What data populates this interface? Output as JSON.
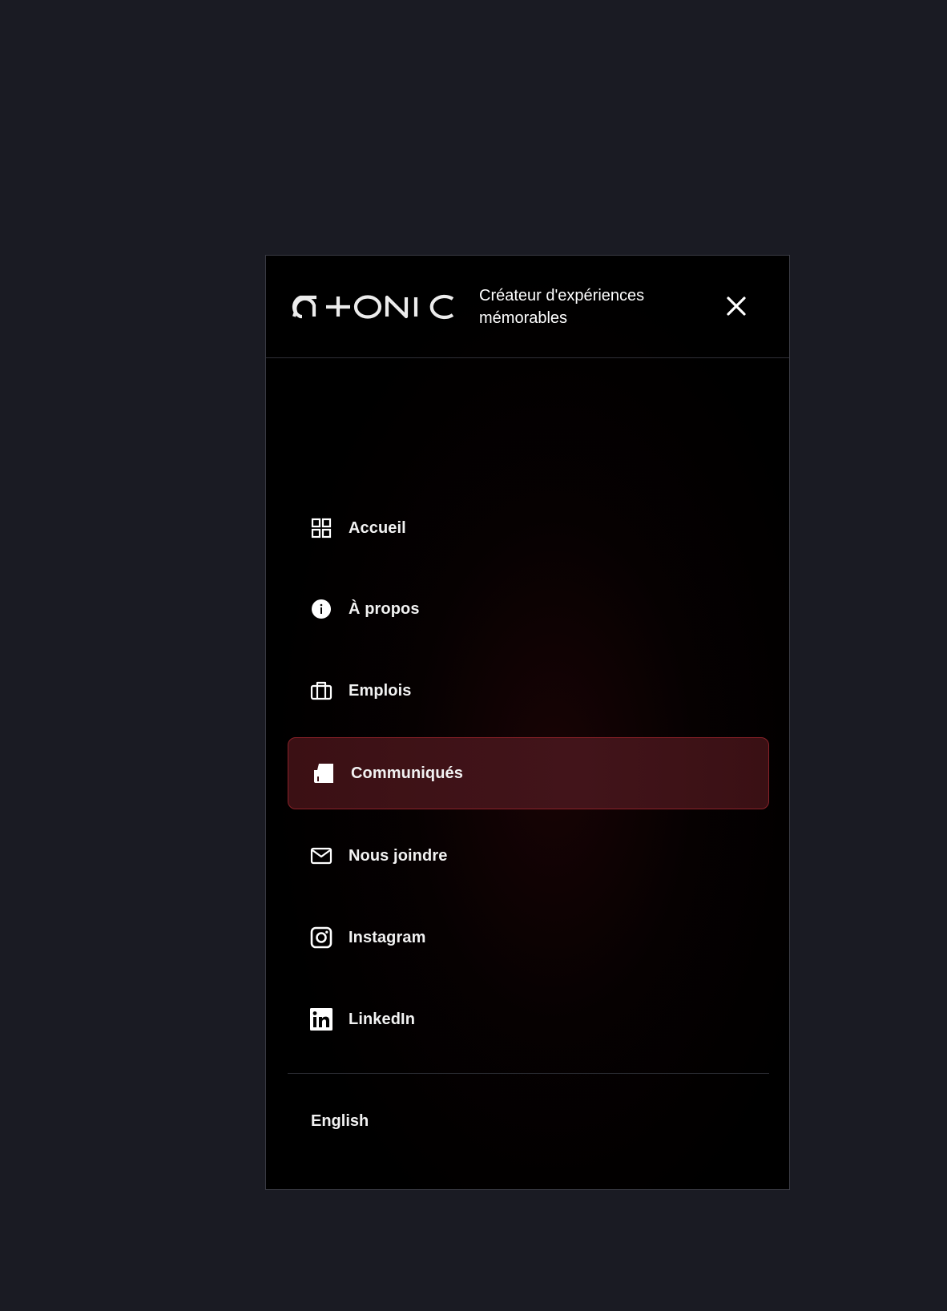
{
  "brand": {
    "logo_text": "G+ONIC",
    "tagline": "Créateur d'expériences mémorables"
  },
  "header": {
    "close_icon": "close-icon"
  },
  "nav": {
    "items": [
      {
        "label": "Accueil",
        "icon": "grid-icon",
        "active": false
      },
      {
        "label": "À propos",
        "icon": "info-icon",
        "active": false
      },
      {
        "label": "Emplois",
        "icon": "briefcase-icon",
        "active": false
      },
      {
        "label": "Communiqués",
        "icon": "documents-icon",
        "active": true
      },
      {
        "label": "Nous joindre",
        "icon": "envelope-icon",
        "active": false
      },
      {
        "label": "Instagram",
        "icon": "instagram-icon",
        "active": false
      },
      {
        "label": "LinkedIn",
        "icon": "linkedin-icon",
        "active": false
      }
    ]
  },
  "language_switch": "English",
  "colors": {
    "page_background": "#1a1b23",
    "panel_background": "#000000",
    "active_background": "#3b1014",
    "active_border": "#8a2229",
    "text": "#ffffff"
  }
}
